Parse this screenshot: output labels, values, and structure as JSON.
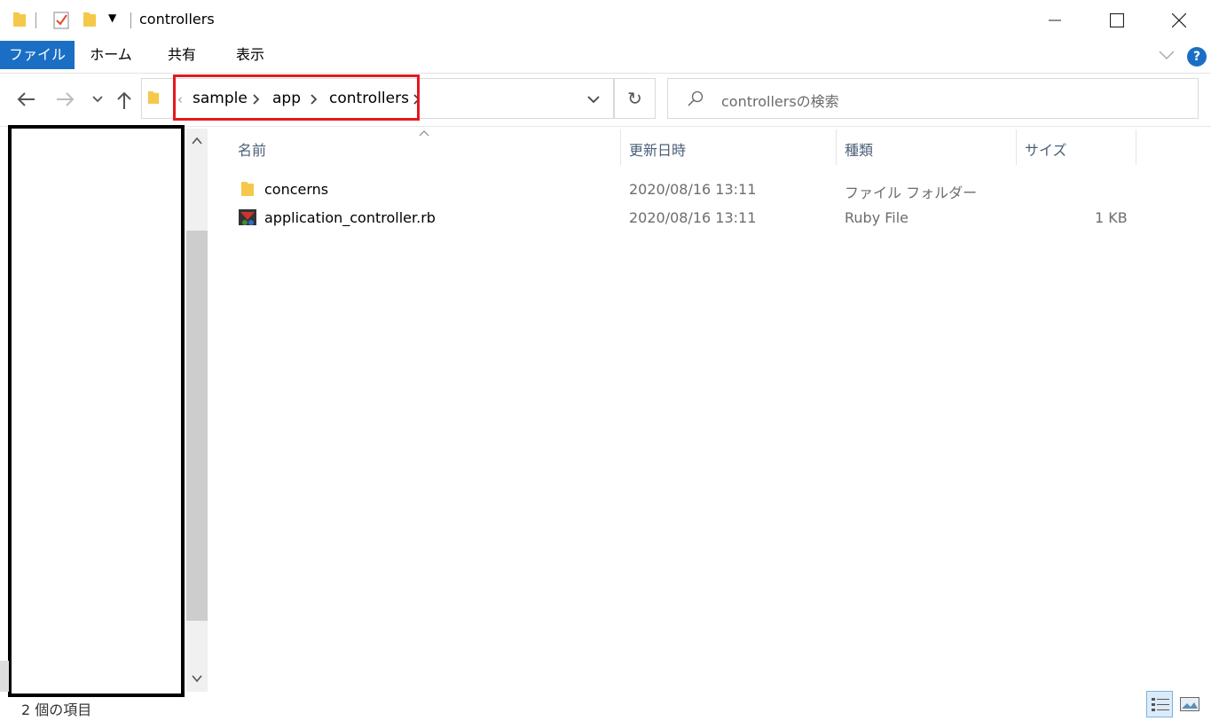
{
  "window": {
    "title": "controllers"
  },
  "ribbon": {
    "tabs": [
      "ファイル",
      "ホーム",
      "共有",
      "表示"
    ],
    "help": "?"
  },
  "address": {
    "overflow": "‹",
    "crumbs": [
      "sample",
      "app",
      "controllers"
    ]
  },
  "search": {
    "placeholder": "controllersの検索"
  },
  "columns": {
    "name": "名前",
    "date": "更新日時",
    "type": "種類",
    "size": "サイズ"
  },
  "files": [
    {
      "name": "concerns",
      "date": "2020/08/16 13:11",
      "type": "ファイル フォルダー",
      "size": "",
      "icon": "folder-icon"
    },
    {
      "name": "application_controller.rb",
      "date": "2020/08/16 13:11",
      "type": "Ruby File",
      "size": "1 KB",
      "icon": "ruby-file-icon"
    }
  ],
  "status": {
    "item_count": "2 個の項目"
  },
  "colors": {
    "accent": "#1a6fc4",
    "highlight_box": "#e3191f",
    "folder": "#f5c84c"
  }
}
